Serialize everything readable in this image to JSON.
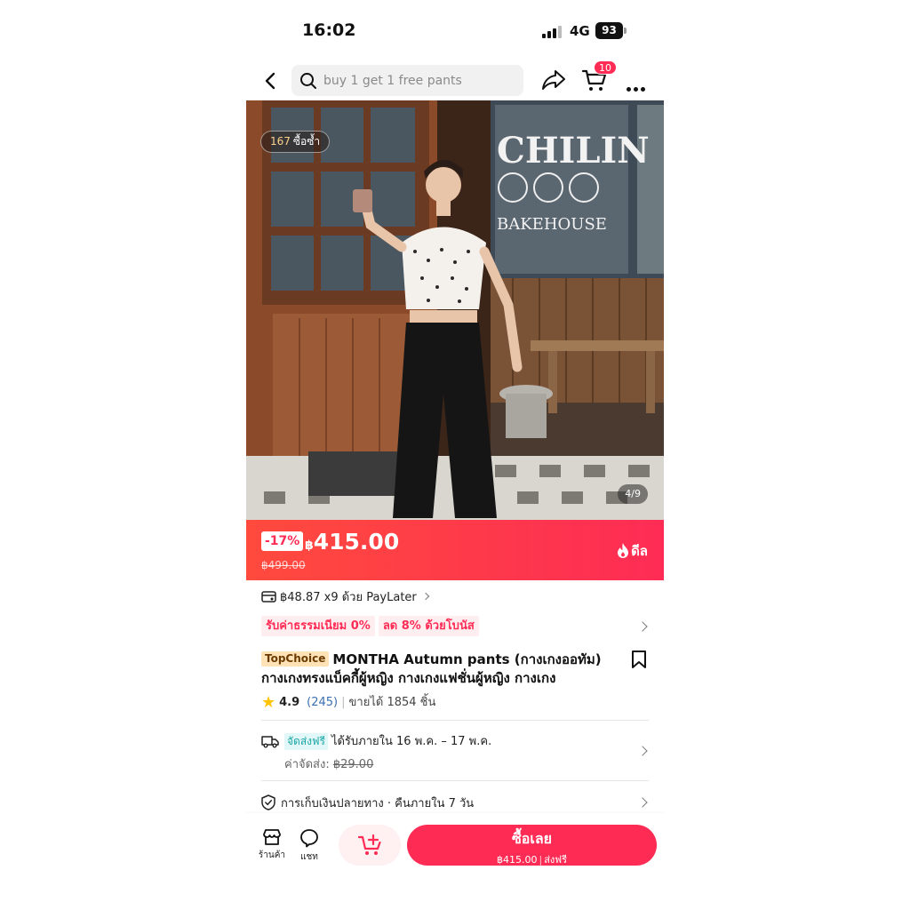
{
  "status": {
    "time": "16:02",
    "network": "4G",
    "battery": "93"
  },
  "nav": {
    "search_placeholder": "buy 1 get 1 free pants",
    "cart_count": "10"
  },
  "image": {
    "reorder_count": "167",
    "reorder_label": "ซื้อซ้ำ",
    "counter": "4/9"
  },
  "price": {
    "discount": "-17%",
    "currency": "฿",
    "amount": "415.00",
    "original": "฿499.00",
    "deal_label": "ดีล"
  },
  "paylater": {
    "text": "฿48.87 x9 ด้วย PayLater"
  },
  "promos": [
    "รับค่าธรรมเนียม 0%",
    "ลด 8% ด้วยโบนัส"
  ],
  "product": {
    "badge": "TopChoice",
    "title": "MONTHA Autumn pants (กางเกงออทัม) กางเกงทรงแบ็คกี้ผู้หญิง กางเกงแฟชั่นผู้หญิง กางเกง",
    "rating": "4.9",
    "reviews": "(245)",
    "sold": "ขายได้ 1854 ชิ้น"
  },
  "shipping": {
    "free_label": "จัดส่งฟรี",
    "delivery": "ได้รับภายใน 16 พ.ค. – 17 พ.ค.",
    "fee_label": "ค่าจัดส่ง:",
    "fee_old": "฿29.00"
  },
  "cod": {
    "text": "การเก็บเงินปลายทาง · คืนภายใน 7 วัน"
  },
  "bottom": {
    "shop_label": "ร้านค้า",
    "chat_label": "แชท",
    "buy_label": "ซื้อเลย",
    "buy_price": "฿415.00",
    "buy_shipping": "ส่งฟรี"
  },
  "colors": {
    "accent": "#fe2c55",
    "star": "#ffc300"
  }
}
